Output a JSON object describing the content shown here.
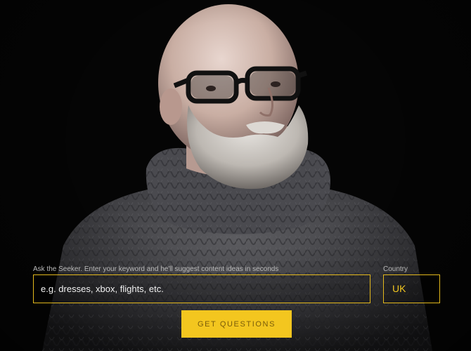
{
  "hero": {
    "description_icon": "bearded-man-portrait"
  },
  "seeker": {
    "keyword_label": "Ask the Seeker. Enter your keyword and he'll suggest content ideas in seconds",
    "keyword_placeholder": "e.g. dresses, xbox, flights, etc.",
    "keyword_value": "",
    "country_label": "Country",
    "country_value": "UK",
    "submit_label": "GET QUESTIONS"
  },
  "colors": {
    "accent": "#f3c61f",
    "border": "#e3b81c",
    "background": "#050505"
  }
}
